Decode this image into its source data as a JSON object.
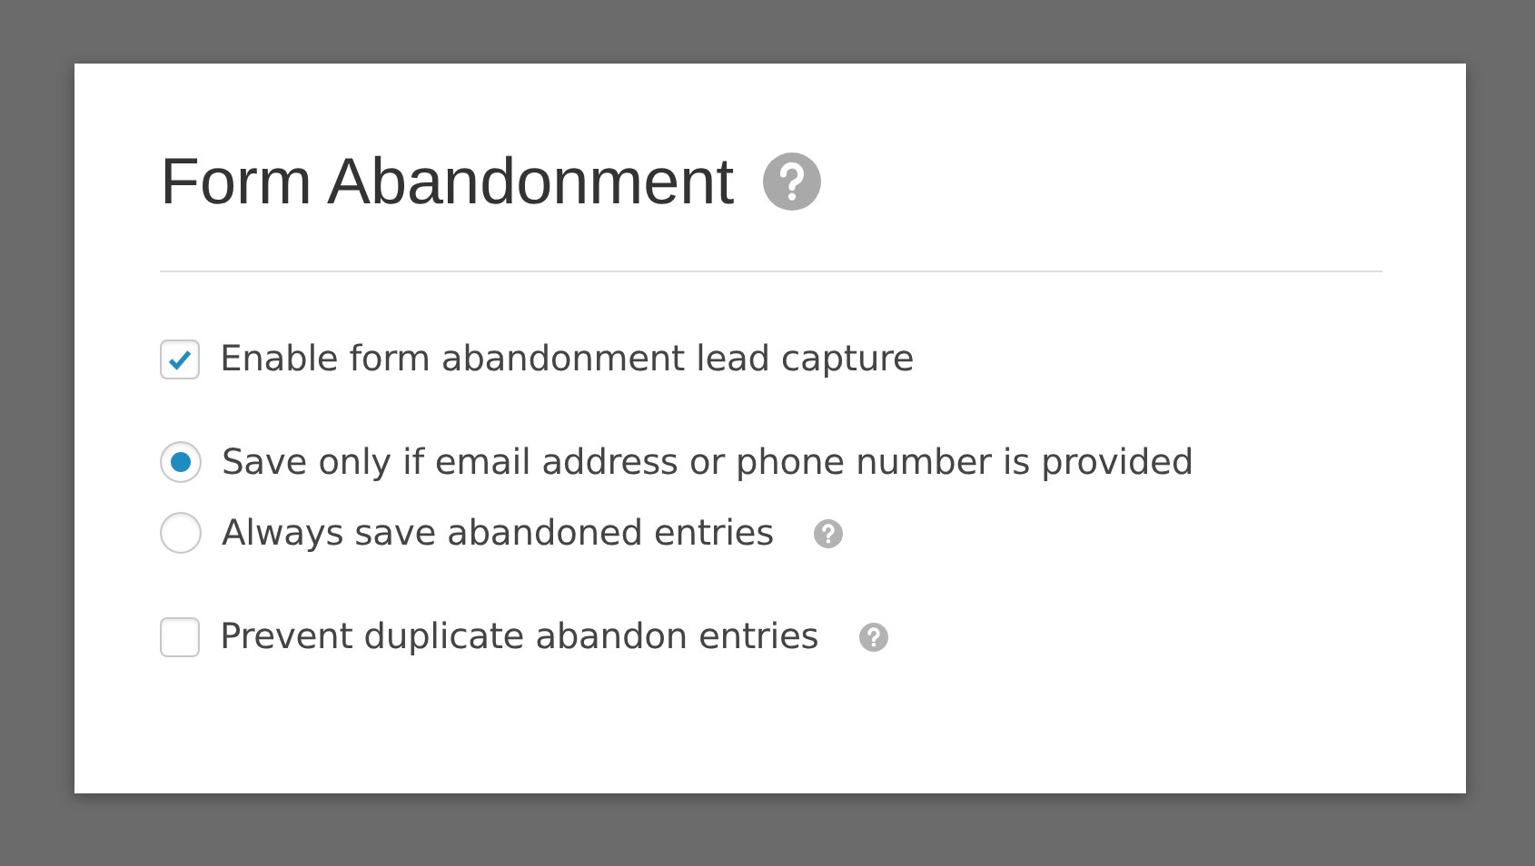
{
  "panel": {
    "title": "Form Abandonment",
    "title_help": true,
    "groups": [
      {
        "items": [
          {
            "kind": "checkbox",
            "label": "Enable form abandonment lead capture",
            "checked": true,
            "help": false
          }
        ]
      },
      {
        "items": [
          {
            "kind": "radio",
            "label": "Save only if email address or phone number is provided",
            "selected": true,
            "help": false
          },
          {
            "kind": "radio",
            "label": "Always save abandoned entries",
            "selected": false,
            "help": true
          }
        ]
      },
      {
        "items": [
          {
            "kind": "checkbox",
            "label": "Prevent duplicate abandon entries",
            "checked": false,
            "help": true
          }
        ]
      }
    ]
  }
}
